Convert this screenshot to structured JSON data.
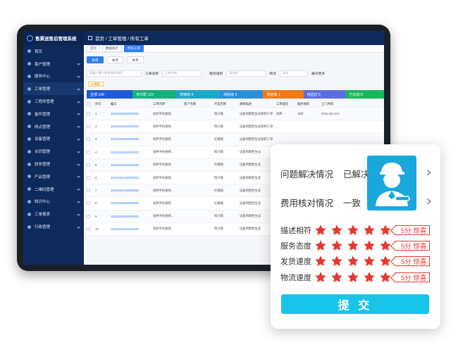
{
  "app": {
    "title": "售票送售后管理系统",
    "breadcrumb": "首页 / 工单管理 / 所有工单"
  },
  "sidebar": {
    "items": [
      {
        "label": "首页"
      },
      {
        "label": "客户管理"
      },
      {
        "label": "服务中心"
      },
      {
        "label": "工单管理"
      },
      {
        "label": "工程师管理"
      },
      {
        "label": "备件管理"
      },
      {
        "label": "网点管理"
      },
      {
        "label": "设备管理"
      },
      {
        "label": "合同管理"
      },
      {
        "label": "财务管理"
      },
      {
        "label": "产品管理"
      },
      {
        "label": "二维码管理"
      },
      {
        "label": "知识中心"
      },
      {
        "label": "工单报表"
      },
      {
        "label": "行政管理"
      }
    ]
  },
  "tabs": [
    {
      "label": "首页"
    },
    {
      "label": "数据统计"
    },
    {
      "label": "所有工单"
    }
  ],
  "filters": {
    "today": "本周",
    "month": "本月",
    "year": "本年"
  },
  "search": {
    "customer_placeholder": "请输入客户名称/联系电话",
    "order_name_label": "工单名称",
    "order_name_placeholder": "工单名称",
    "service_org_label": "服务组织",
    "service_org_placeholder": "请选择",
    "site_label": "网点",
    "site_placeholder": "请选",
    "more_label": "展开更多"
  },
  "warn_tag": "● 筛选",
  "stats": [
    {
      "label": "全部 148",
      "color": "#1d5bd6"
    },
    {
      "label": "待分配 123",
      "color": "#13b07b"
    },
    {
      "label": "待接收 4",
      "color": "#1fa5c9"
    },
    {
      "label": "待验收 6",
      "color": "#2a8fd8"
    },
    {
      "label": "待结算 1",
      "color": "#f07a1a"
    },
    {
      "label": "待回访 5",
      "color": "#5b6ee0"
    },
    {
      "label": "已完成 8",
      "color": "#18b65a"
    }
  ],
  "table": {
    "headers": [
      "",
      "序号",
      "编号",
      "工单名称",
      "客户名称",
      "产品名称",
      "故障描述",
      "工单类型",
      "服务组织",
      "上门时间"
    ],
    "rows": [
      {
        "no": "1",
        "code": "J2022082300000002",
        "name": "保养手机维修...",
        "customer": "",
        "product": "制冷箱",
        "desc": "设备周期性生成保养工单",
        "type": "保养",
        "org": "未知",
        "time": "2022-08-23 0"
      },
      {
        "no": "2",
        "code": "J2022082300000001",
        "name": "保养手机维修...",
        "customer": "",
        "product": "制冷箱",
        "desc": "设备周期性生成保养工单",
        "type": "",
        "org": "",
        "time": ""
      },
      {
        "no": "3",
        "code": "J2022082300000002",
        "name": "保养手机维修...",
        "customer": "",
        "product": "柠檬箱",
        "desc": "设备周期性生成保养工单",
        "type": "",
        "org": "",
        "time": ""
      },
      {
        "no": "4",
        "code": "J2022082200000001",
        "name": "保养手机维修...",
        "customer": "",
        "product": "制冷箱",
        "desc": "设备周期性生成",
        "type": "",
        "org": "",
        "time": ""
      },
      {
        "no": "5",
        "code": "J2022082200000002",
        "name": "保养手机维修...",
        "customer": "",
        "product": "柠檬箱",
        "desc": "设备周期性生成",
        "type": "",
        "org": "",
        "time": ""
      },
      {
        "no": "6",
        "code": "J2022082100000001",
        "name": "保养手机维修...",
        "customer": "",
        "product": "制冷箱",
        "desc": "设备周期性生成",
        "type": "",
        "org": "",
        "time": ""
      },
      {
        "no": "7",
        "code": "J2022082100000002",
        "name": "保养手机维修...",
        "customer": "",
        "product": "柠檬箱",
        "desc": "设备周期性生成",
        "type": "",
        "org": "",
        "time": ""
      },
      {
        "no": "8",
        "code": "J2022082000000002",
        "name": "保养手机维修...",
        "customer": "",
        "product": "柠檬箱",
        "desc": "设备周期性生成",
        "type": "",
        "org": "",
        "time": ""
      },
      {
        "no": "9",
        "code": "J2022081900000001",
        "name": "保养手机维修...",
        "customer": "",
        "product": "制冷箱",
        "desc": "设备周期性生成",
        "type": "",
        "org": "",
        "time": ""
      },
      {
        "no": "10",
        "code": "J2022081900000002",
        "name": "保养手机维修...",
        "customer": "",
        "product": "制冷箱",
        "desc": "设备周期性生成",
        "type": "",
        "org": "",
        "time": ""
      }
    ]
  },
  "review": {
    "problem_label": "问题解决情况",
    "problem_value": "已解决",
    "fee_label": "费用核对情况",
    "fee_value": "一致",
    "ratings": [
      {
        "label": "描述相符",
        "stars": 5,
        "badge": "5分 惊喜"
      },
      {
        "label": "服务态度",
        "stars": 5,
        "badge": "5分 惊喜"
      },
      {
        "label": "发货速度",
        "stars": 5,
        "badge": "5分 惊喜"
      },
      {
        "label": "物流速度",
        "stars": 5,
        "badge": "5分 惊喜"
      }
    ],
    "submit_label": "提 交",
    "accent": "#18c4e8",
    "star_color": "#e33a2f"
  }
}
